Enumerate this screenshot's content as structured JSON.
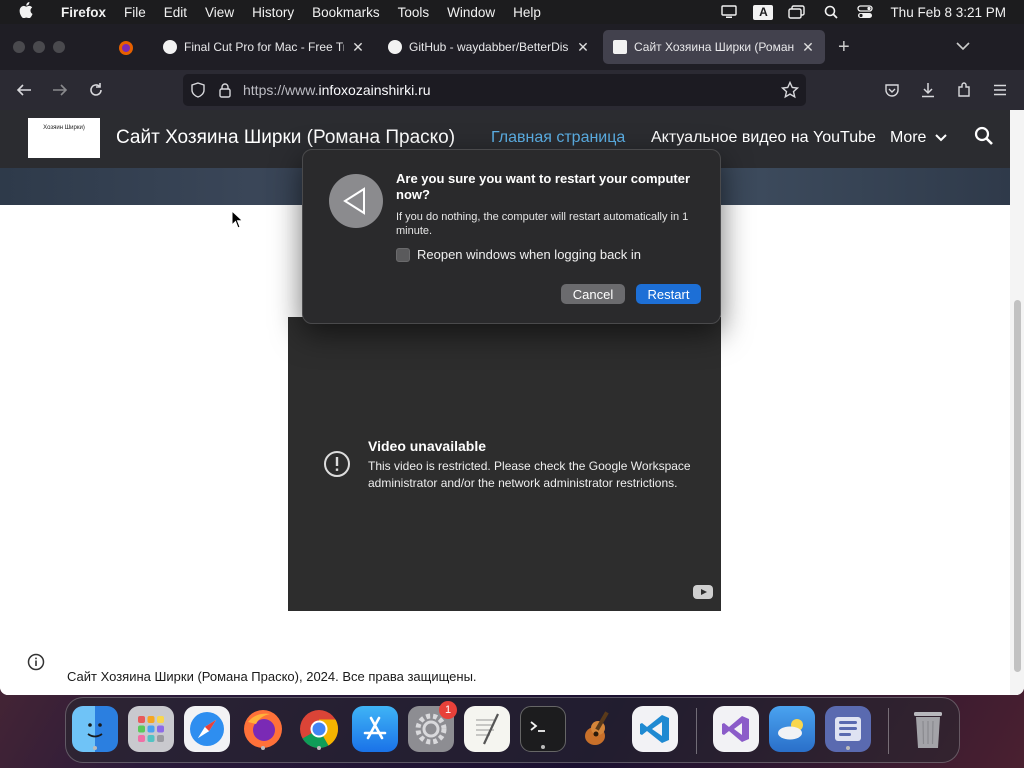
{
  "menubar": {
    "app": "Firefox",
    "items": [
      "File",
      "Edit",
      "View",
      "History",
      "Bookmarks",
      "Tools",
      "Window",
      "Help"
    ],
    "input_badge": "A",
    "clock": "Thu Feb 8  3:21 PM"
  },
  "tabs": [
    {
      "title": "Final Cut Pro for Mac - Free Tria",
      "favicon": "final-cut-icon"
    },
    {
      "title": "GitHub - waydabber/BetterDispl",
      "favicon": "github-icon"
    },
    {
      "title": "Сайт Хозяина Ширки (Романа",
      "favicon": "site-icon"
    }
  ],
  "navbar": {
    "url_prefix": "https://www.",
    "url_domain": "infoxozainshirki.ru"
  },
  "site": {
    "logo_text": "Хозяин Ширки)",
    "title": "Сайт Хозяина Ширки (Романа Праско)",
    "nav_main": "Главная страница",
    "nav_youtube": "Актуальное видео на YouTube",
    "nav_more": "More",
    "footer": "Сайт Хозяина Ширки (Романа Праско), 2024. Все права защищены."
  },
  "video": {
    "title": "Video unavailable",
    "message": "This video is restricted. Please check the Google Workspace administrator and/or the network administrator restrictions."
  },
  "dialog": {
    "title": "Are you sure you want to restart your computer now?",
    "text": "If you do nothing, the computer will restart automatically in 1 minute.",
    "checkbox_label": "Reopen windows when logging back in",
    "checkbox_checked": false,
    "cancel": "Cancel",
    "restart": "Restart"
  },
  "dock": {
    "apps": [
      "finder",
      "launchpad",
      "safari",
      "firefox",
      "chrome",
      "app-store",
      "system-settings",
      "textedit",
      "terminal",
      "garageband",
      "vscode",
      "visual-studio",
      "weather",
      "utility",
      "trash"
    ],
    "settings_badge": "1"
  },
  "colors": {
    "accent_link": "#5cb0e6",
    "restart_button": "#1d6fd6",
    "badge": "#e8413a"
  }
}
